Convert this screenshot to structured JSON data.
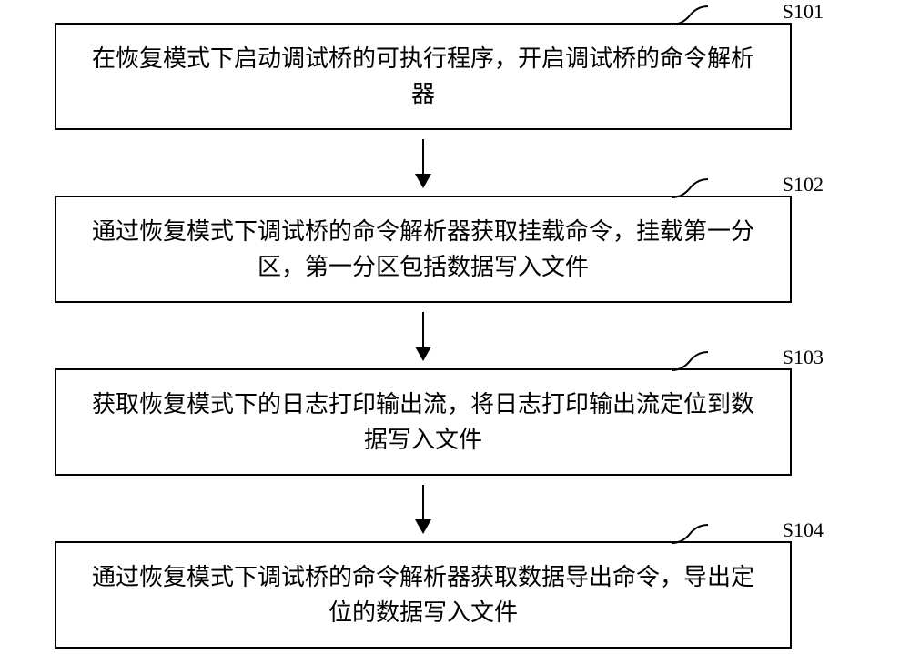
{
  "diagram": {
    "steps": [
      {
        "label": "S101",
        "text": "在恢复模式下启动调试桥的可执行程序，开启调试桥的命令解析器"
      },
      {
        "label": "S102",
        "text": "通过恢复模式下调试桥的命令解析器获取挂载命令，挂载第一分区，第一分区包括数据写入文件"
      },
      {
        "label": "S103",
        "text": "获取恢复模式下的日志打印输出流，将日志打印输出流定位到数据写入文件"
      },
      {
        "label": "S104",
        "text": "通过恢复模式下调试桥的命令解析器获取数据导出命令，导出定位的数据写入文件"
      }
    ]
  }
}
